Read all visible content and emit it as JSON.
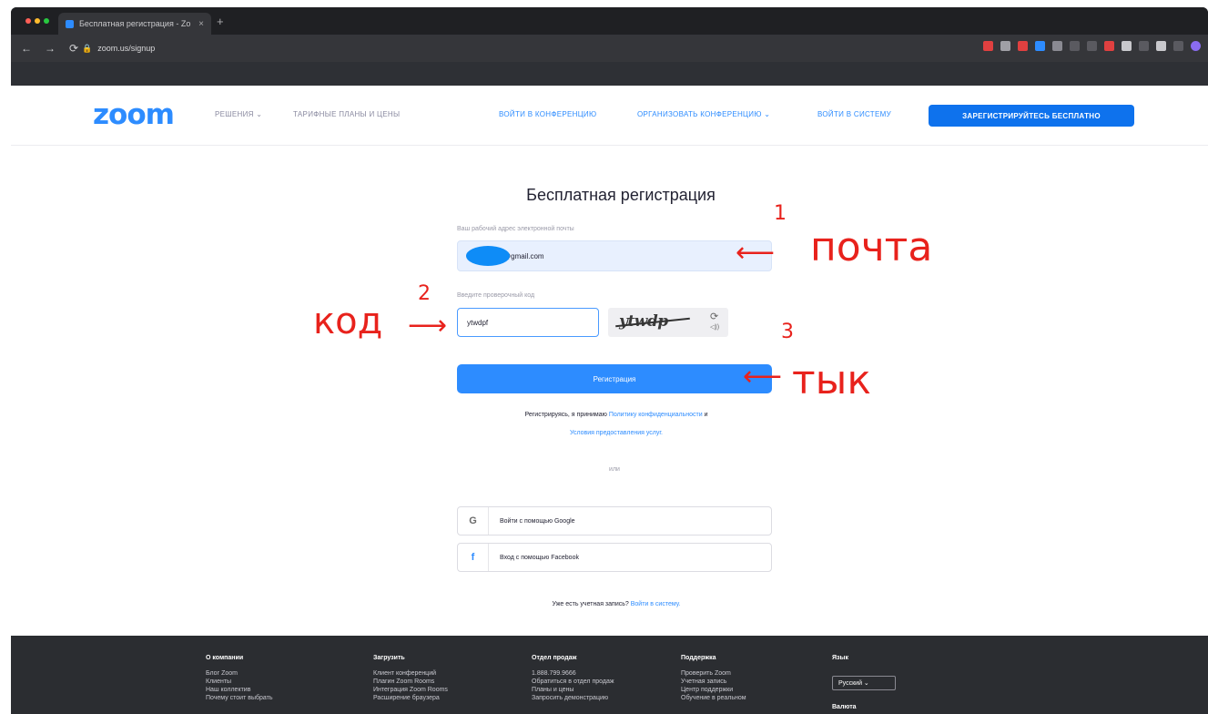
{
  "browser": {
    "tab_title": "Бесплатная регистрация - Zo",
    "tab_close": "×",
    "new_tab": "+",
    "url": "zoom.us/signup",
    "nav_back": "←",
    "nav_forward": "→",
    "nav_reload": "⟳",
    "lock": "🔒"
  },
  "topnav": {
    "logo": "zoom",
    "links": [
      {
        "label": "РЕШЕНИЯ ⌄"
      },
      {
        "label": "ТАРИФНЫЕ ПЛАНЫ И ЦЕНЫ"
      },
      {
        "label": "ВОЙТИ В КОНФЕРЕНЦИЮ"
      },
      {
        "label": "ОРГАНИЗОВАТЬ КОНФЕРЕНЦИЮ ⌄"
      },
      {
        "label": "ВОЙТИ В СИСТЕМУ"
      }
    ],
    "signup_button": "ЗАРЕГИСТРИРУЙТЕСЬ БЕСПЛАТНО"
  },
  "form": {
    "title": "Бесплатная регистрация",
    "email_label": "Ваш рабочий адрес электронной почты",
    "email_value": "@gmail.com",
    "code_label": "Введите проверочный код",
    "code_value": "ytwdpf",
    "captcha_text": "ytwdp",
    "captcha_refresh": "⟳",
    "captcha_audio": "◁))",
    "register_button": "Регистрация",
    "terms_prefix": "Регистрируясь, я принимаю",
    "terms_privacy": "Политику конфиденциальности",
    "terms_and": "и",
    "terms_service": "Условия предоставления услуг.",
    "or": "или",
    "google_icon": "G",
    "google_label": "Войти с помощью Google",
    "facebook_icon": "f",
    "facebook_label": "Вход с помощью Facebook",
    "have_account": "Уже есть учетная запись?",
    "sign_in_link": "Войти в систему."
  },
  "annotations": {
    "a1_num": "1",
    "a1_text": "почта",
    "a2_text": "код",
    "a2_num": "2",
    "a3_num": "3",
    "a3_text": "тык",
    "color": "#e8221c"
  },
  "footer": {
    "columns": [
      {
        "head": "О компании",
        "items": [
          "Блог Zoom",
          "Клиенты",
          "Наш коллектив",
          "Почему стоит выбрать"
        ]
      },
      {
        "head": "Загрузить",
        "items": [
          "Клиент конференций",
          "Плагин Zoom Rooms",
          "Интеграция Zoom Rooms",
          "Расширение браузера"
        ]
      },
      {
        "head": "Отдел продаж",
        "items": [
          "1.888.799.9666",
          "Обратиться в отдел продаж",
          "Планы и цены",
          "Запросить демонстрацию"
        ]
      },
      {
        "head": "Поддержка",
        "items": [
          "Проверить Zoom",
          "Учетная запись",
          "Центр поддержки",
          "Обучение в реальном"
        ]
      }
    ],
    "lang_head": "Язык",
    "lang_value": "Русский ⌄",
    "currency_head": "Валюта"
  },
  "colors": {
    "accent": "#2d8cff",
    "signup_bg": "#0e72ed",
    "annotation": "#e8221c",
    "footer_bg": "#2b2d31"
  }
}
